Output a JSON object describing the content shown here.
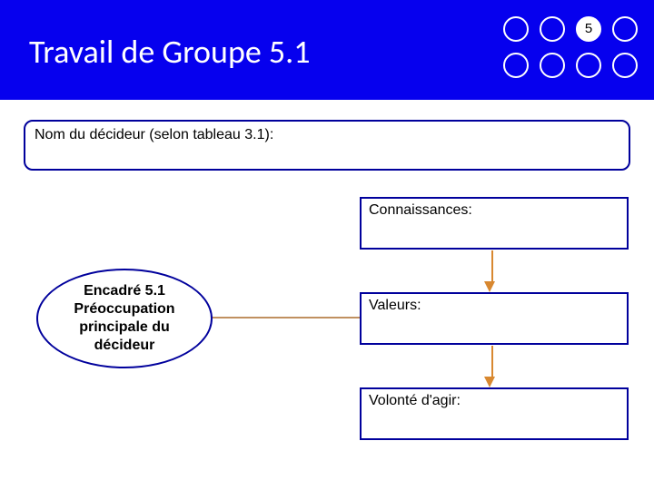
{
  "header": {
    "title": "Travail de Groupe 5.1",
    "slide_number": "5"
  },
  "name_box": {
    "label": "Nom du décideur (selon tableau 3.1):"
  },
  "oval": {
    "text": "Encadré 5.1 Préoccupation principale du décideur"
  },
  "boxes": {
    "knowledge": "Connaissances:",
    "values": "Valeurs:",
    "will": "Volonté d'agir:"
  }
}
